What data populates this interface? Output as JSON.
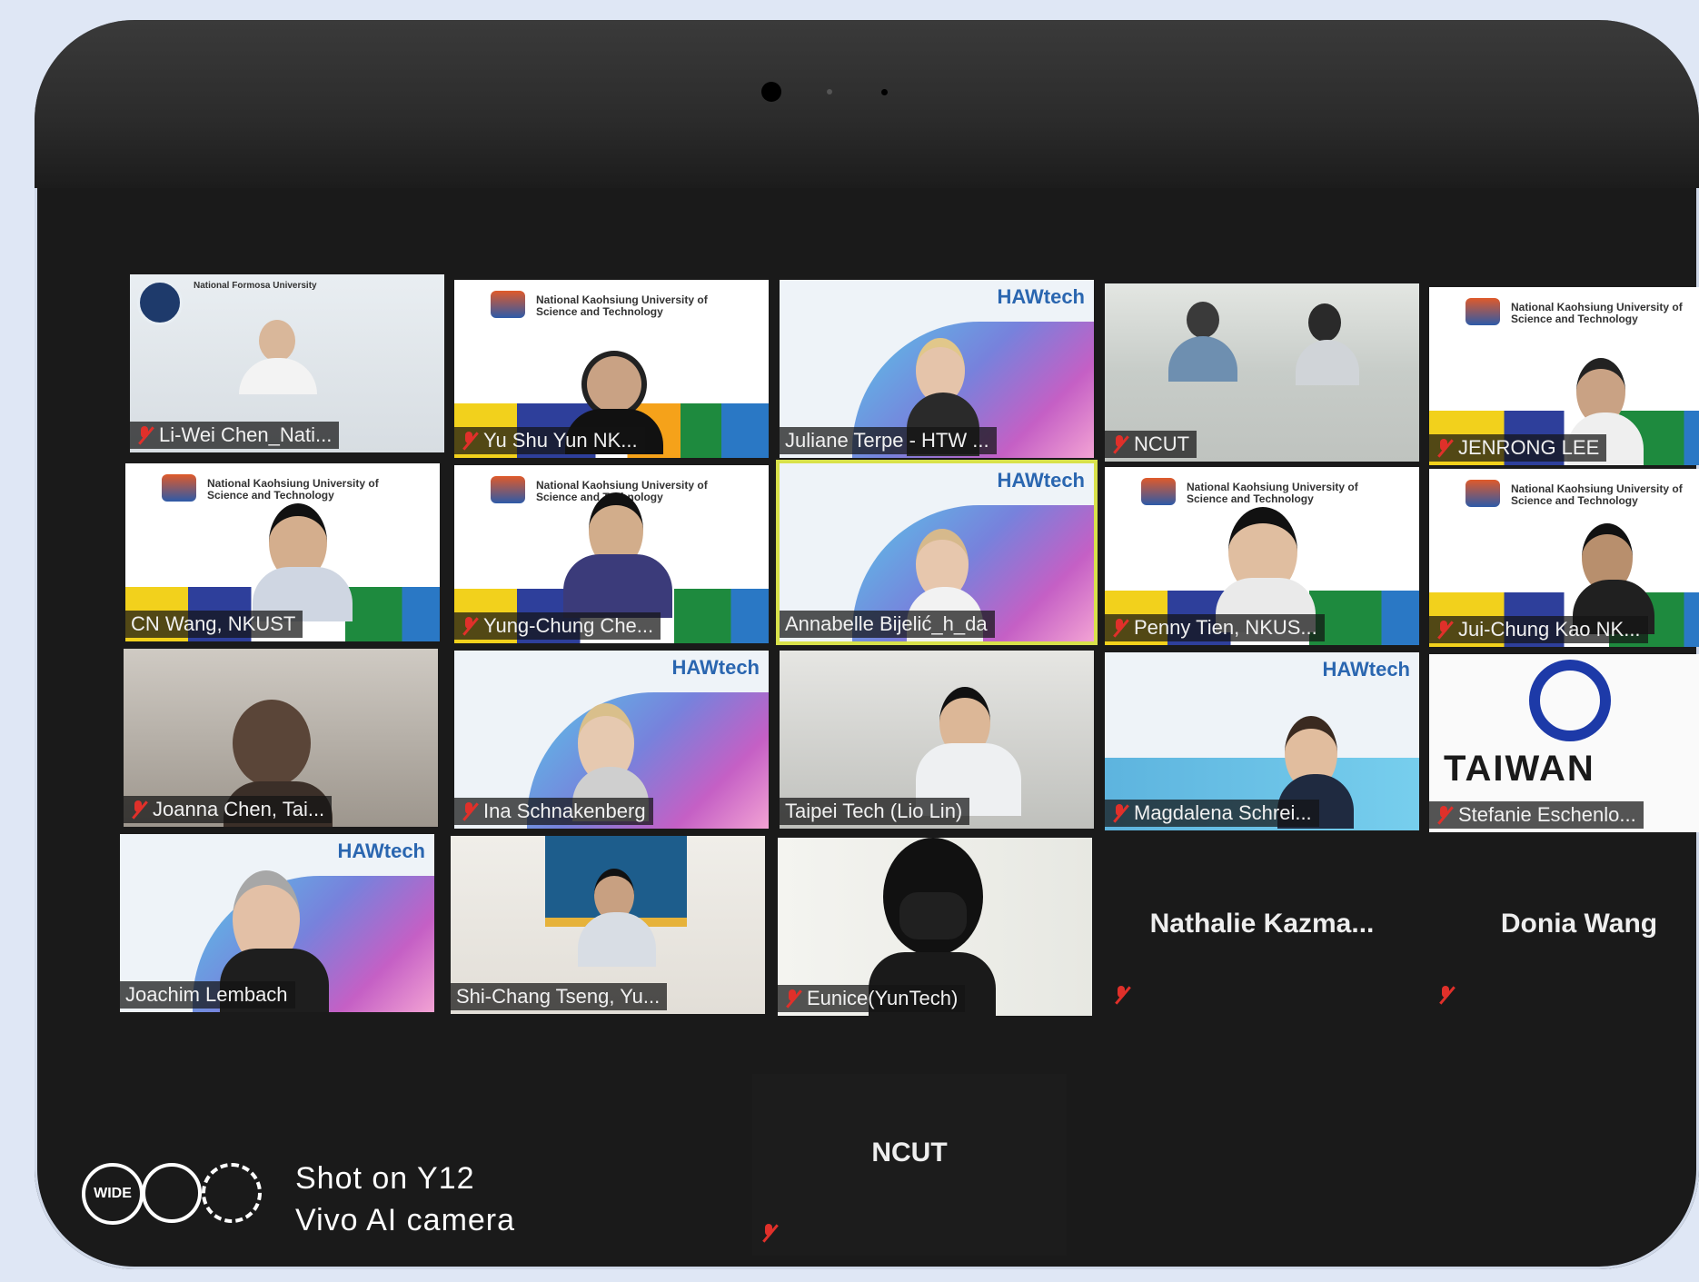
{
  "watermark": {
    "line1": "Shot on Y12",
    "line2": "Vivo AI camera",
    "wide_label": "WIDE"
  },
  "brand": {
    "haw": "HAWtech",
    "nkust": "National Kaohsiung University of Science and Technology",
    "nfu": "National Formosa University",
    "taiwan": "TAIWAN"
  },
  "participants": [
    {
      "name": "Li-Wei Chen_Nati...",
      "muted": true
    },
    {
      "name": "Yu Shu Yun   NK...",
      "muted": true
    },
    {
      "name": "Juliane Terpe - HTW ...",
      "muted": false
    },
    {
      "name": "NCUT",
      "muted": true
    },
    {
      "name": "JENRONG LEE",
      "muted": true
    },
    {
      "name": "CN Wang, NKUST",
      "muted": false
    },
    {
      "name": "Yung-Chung Che...",
      "muted": true
    },
    {
      "name": "Annabelle Bijelić_h_da",
      "muted": false,
      "active": true
    },
    {
      "name": "Penny Tien, NKUS...",
      "muted": true
    },
    {
      "name": "Jui-Chung Kao NK...",
      "muted": true
    },
    {
      "name": "Joanna Chen, Tai...",
      "muted": true
    },
    {
      "name": "Ina Schnakenberg",
      "muted": true
    },
    {
      "name": "Taipei Tech (Lio Lin)",
      "muted": false
    },
    {
      "name": "Magdalena Schrei...",
      "muted": true
    },
    {
      "name": "Stefanie Eschenlo...",
      "muted": true
    },
    {
      "name": "Joachim Lembach",
      "muted": false
    },
    {
      "name": "Shi-Chang Tseng, Yu...",
      "muted": false
    },
    {
      "name": "Eunice(YunTech)",
      "muted": true
    },
    {
      "name": "Nathalie  Kazma...",
      "muted": true
    },
    {
      "name": "Donia Wang",
      "muted": true
    },
    {
      "name": "NCUT",
      "muted": true
    }
  ]
}
